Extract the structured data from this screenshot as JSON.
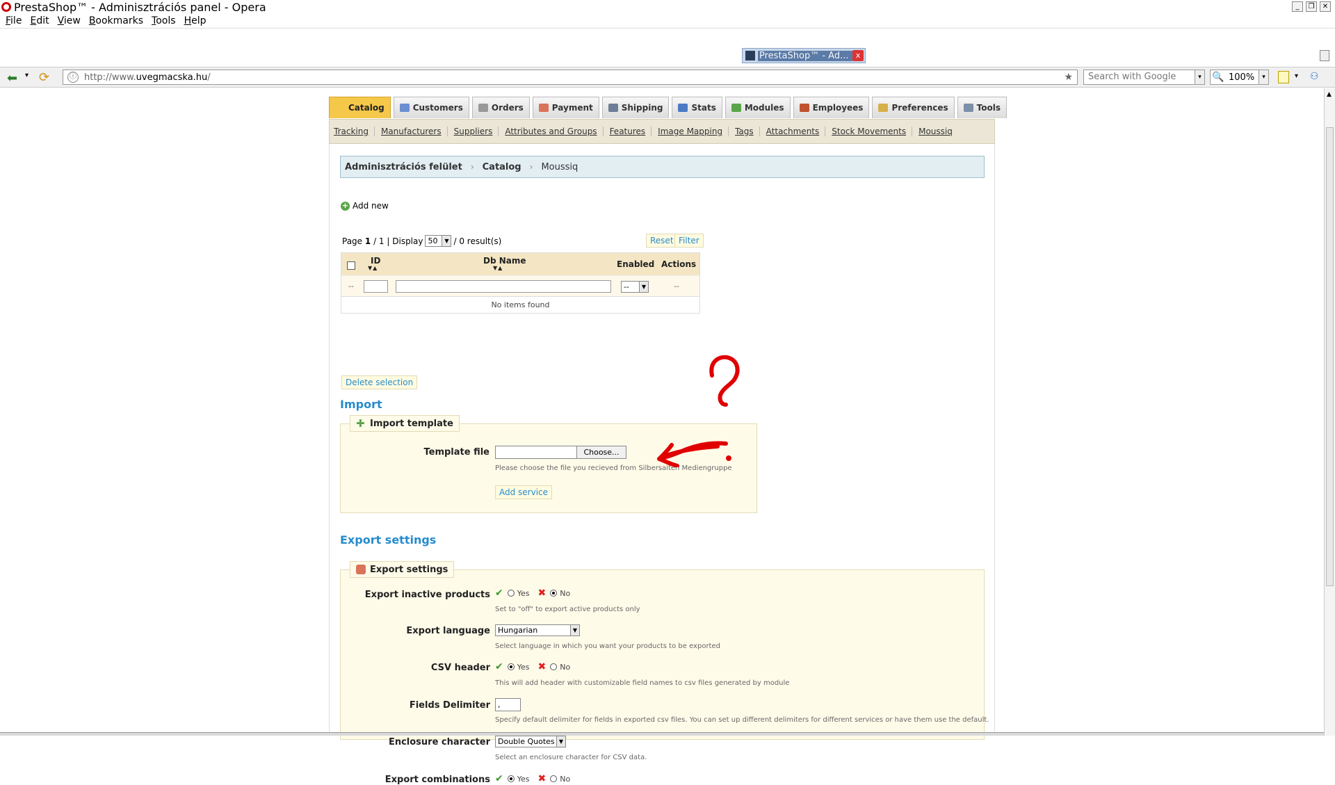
{
  "window": {
    "title": "PrestaShop™ - Adminisztrációs panel - Opera"
  },
  "menu": [
    "File",
    "Edit",
    "View",
    "Bookmarks",
    "Tools",
    "Help"
  ],
  "browser": {
    "tab_label": "PrestaShop™ - Ad...",
    "url_prefix": "http://www.",
    "url_domain": "uvegmacska.hu",
    "url_suffix": "/",
    "search_placeholder": "Search with Google",
    "zoom": "100%"
  },
  "nav_tabs": [
    {
      "label": "Catalog",
      "color": "#f5c84a"
    },
    {
      "label": "Customers",
      "color": "#6b8fd1"
    },
    {
      "label": "Orders",
      "color": "#999999"
    },
    {
      "label": "Payment",
      "color": "#d9735a"
    },
    {
      "label": "Shipping",
      "color": "#6c7d95"
    },
    {
      "label": "Stats",
      "color": "#4a7bc4"
    },
    {
      "label": "Modules",
      "color": "#5aa54a"
    },
    {
      "label": "Employees",
      "color": "#c0522f"
    },
    {
      "label": "Preferences",
      "color": "#d6b04a"
    },
    {
      "label": "Tools",
      "color": "#7b8fa8"
    }
  ],
  "subnav": [
    "Tracking",
    "Manufacturers",
    "Suppliers",
    "Attributes and Groups",
    "Features",
    "Image Mapping",
    "Tags",
    "Attachments",
    "Stock Movements",
    "Moussiq"
  ],
  "breadcrumb": {
    "root": "Adminisztrációs felület",
    "section": "Catalog",
    "current": "Moussiq",
    "sep": "›"
  },
  "list": {
    "add_new": "Add new",
    "page_label": "Page",
    "page_current": "1",
    "page_total": "/ 1 | Display",
    "display_value": "50",
    "results": "/ 0 result(s)",
    "reset": "Reset",
    "filter": "Filter",
    "columns": {
      "id": "ID",
      "db_name": "Db Name",
      "enabled": "Enabled",
      "actions": "Actions"
    },
    "filter_placeholder": "--",
    "enabled_filter": "--",
    "actions_filter": "--",
    "empty": "No items found",
    "delete_selection": "Delete selection"
  },
  "import": {
    "title": "Import",
    "legend": "Import template",
    "template_label": "Template file",
    "choose": "Choose...",
    "help": "Please choose the file you recieved from Silbersaiten Mediengruppe",
    "add_service": "Add service"
  },
  "export": {
    "title": "Export settings",
    "legend": "Export settings",
    "inactive": {
      "label": "Export inactive products",
      "yes": "Yes",
      "no": "No",
      "selected": "no",
      "help": "Set to \"off\" to export active products only"
    },
    "language": {
      "label": "Export language",
      "value": "Hungarian",
      "help": "Select language in which you want your products to be exported"
    },
    "csv_header": {
      "label": "CSV header",
      "yes": "Yes",
      "no": "No",
      "selected": "yes",
      "help": "This will add header with customizable field names to csv files generated by module"
    },
    "delimiter": {
      "label": "Fields Delimiter",
      "value": ",",
      "help": "Specify default delimiter for fields in exported csv files. You can set up different delimiters for different services or have them use the default."
    },
    "enclosure": {
      "label": "Enclosure character",
      "value": "Double Quotes",
      "help": "Select an enclosure character for CSV data."
    },
    "combinations": {
      "label": "Export combinations",
      "yes": "Yes",
      "no": "No",
      "selected": "yes"
    }
  },
  "annotation_color": "#e00000"
}
